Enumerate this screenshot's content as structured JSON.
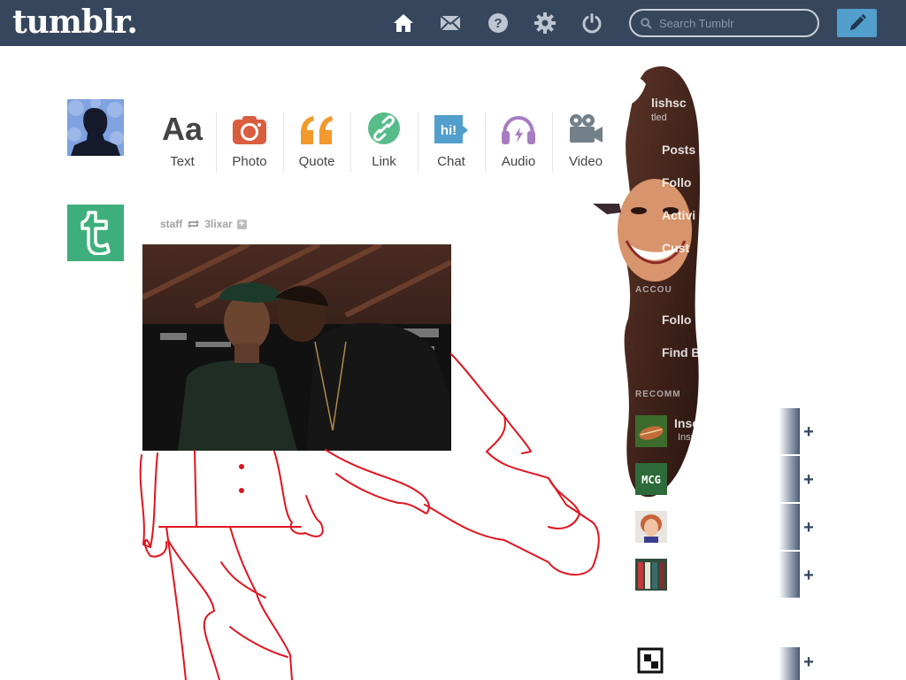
{
  "header": {
    "logo": "tumblr.",
    "search_placeholder": "Search Tumblr",
    "nav": [
      "home-icon",
      "mail-icon",
      "help-icon",
      "settings-icon",
      "power-icon"
    ],
    "compose_icon": "pencil-icon"
  },
  "post_types": [
    {
      "label": "Text",
      "icon": "text-icon",
      "color": "#444444"
    },
    {
      "label": "Photo",
      "icon": "camera-icon",
      "color": "#d95e40"
    },
    {
      "label": "Quote",
      "icon": "quote-icon",
      "color": "#f2992e"
    },
    {
      "label": "Link",
      "icon": "link-icon",
      "color": "#56bc8a"
    },
    {
      "label": "Chat",
      "icon": "chat-icon",
      "color": "#529ecc"
    },
    {
      "label": "Audio",
      "icon": "headphones-icon",
      "color": "#a77dc2"
    },
    {
      "label": "Video",
      "icon": "video-camera-icon",
      "color": "#748089"
    }
  ],
  "post": {
    "author": "staff",
    "reblogged_from": "3lixar"
  },
  "sidebar": {
    "blog_name": "lishsc",
    "blog_sub": "tled",
    "items": [
      "Posts",
      "Follo",
      "Activi",
      "Cust"
    ],
    "account_heading": "ACCOU",
    "account_items": [
      "Follo",
      "Find B"
    ],
    "recommended_heading": "RECOMM",
    "rec_name": "Inse",
    "rec_sub": "Insp",
    "rec_logo": "MCG"
  },
  "colors": {
    "header_bg": "#36465d",
    "accent": "#529ecc",
    "staff_green": "#3eaf7c",
    "drawing_red": "#e0141e"
  }
}
